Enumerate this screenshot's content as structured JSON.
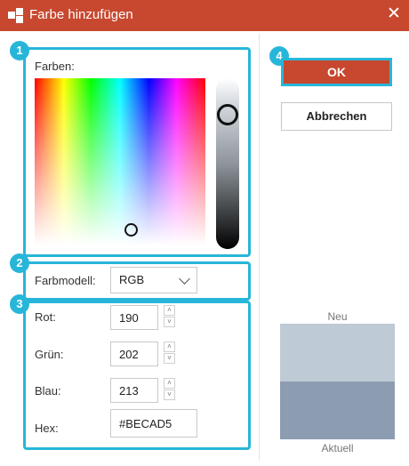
{
  "window": {
    "title": "Farbe hinzufügen",
    "close_glyph": "✕",
    "icon": "color-palette-icon"
  },
  "badges": {
    "b1": "1",
    "b2": "2",
    "b3": "3",
    "b4": "4"
  },
  "colors_panel": {
    "label": "Farben:",
    "hue_fraction": 0.56,
    "saturation_fraction": 0.08,
    "lightness_fraction": 0.2
  },
  "model": {
    "label": "Farbmodell:",
    "selected": "RGB"
  },
  "rgb": {
    "red_label": "Rot:",
    "red_value": "190",
    "green_label": "Grün:",
    "green_value": "202",
    "blue_label": "Blau:",
    "blue_value": "213",
    "hex_label": "Hex:",
    "hex_value": "#BECAD5"
  },
  "buttons": {
    "ok": "OK",
    "cancel": "Abbrechen"
  },
  "preview": {
    "new_label": "Neu",
    "current_label": "Aktuell",
    "new_color": "#becad5",
    "current_color": "#8c9db2"
  },
  "accent_colors": {
    "title_bar": "#c7482f",
    "highlight": "#27b6d9"
  },
  "spinner_glyphs": {
    "up": "˄",
    "down": "˅"
  }
}
